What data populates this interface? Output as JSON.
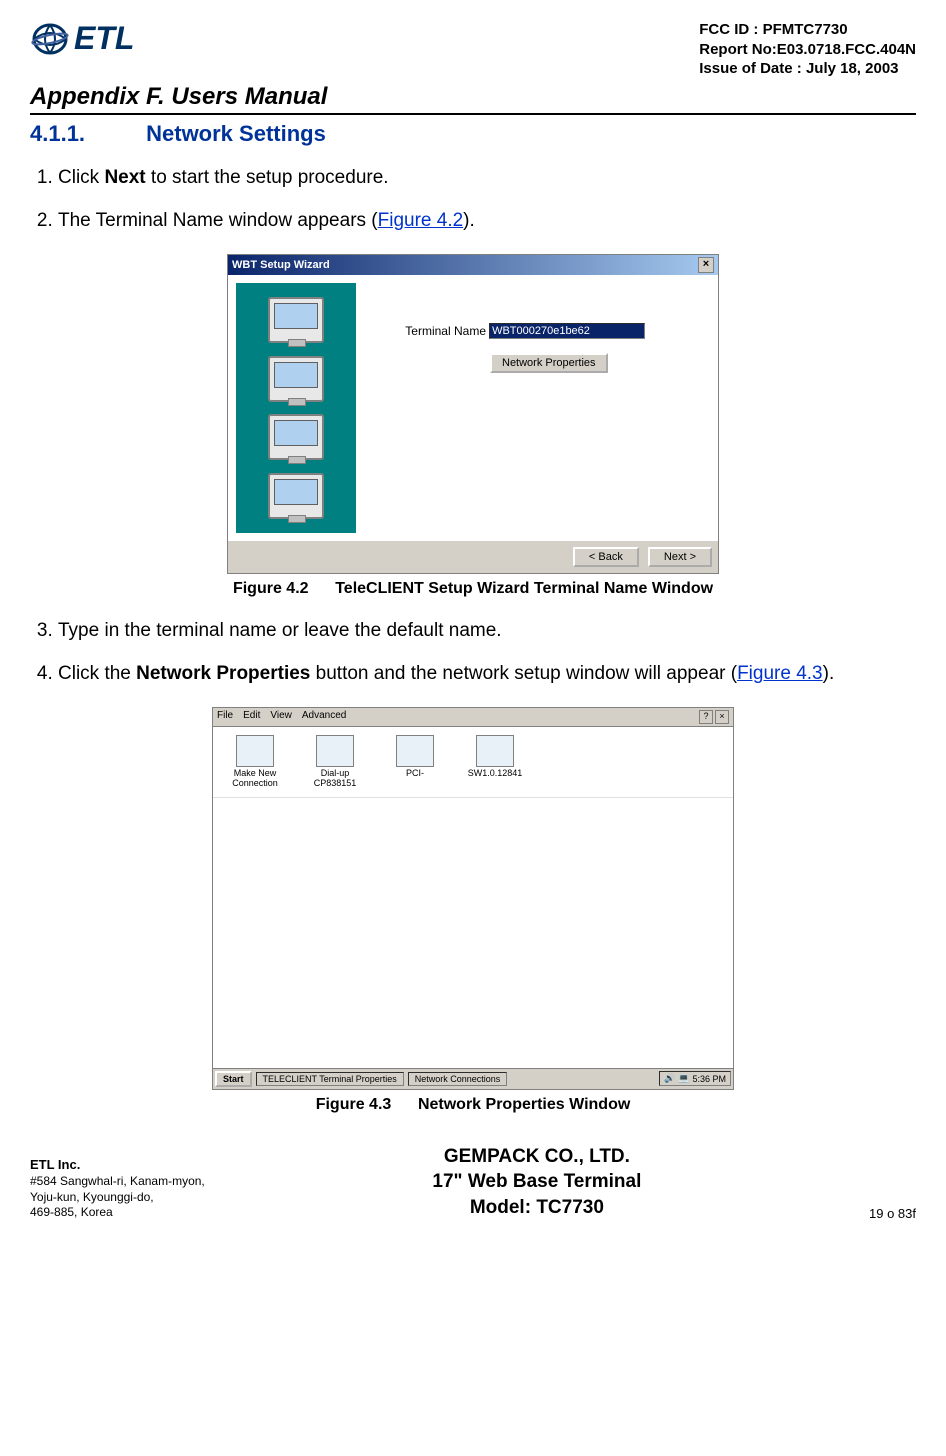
{
  "header": {
    "logo_text": "ETL",
    "fcc_id": "FCC ID : PFMTC7730",
    "report_no": "Report No:E03.0718.FCC.404N",
    "issue_date": "Issue of Date : July 18, 2003",
    "appendix": "Appendix F.  Users Manual"
  },
  "section": {
    "number": "4.1.1.",
    "title": "Network Settings"
  },
  "steps": {
    "s1_pre": "Click ",
    "s1_bold": "Next",
    "s1_post": " to start the setup procedure.",
    "s2_pre": "The Terminal Name window appears (",
    "s2_link": "Figure 4.2",
    "s2_post": ").",
    "s3": "Type in the terminal name or leave the default name.",
    "s4_pre": "Click the ",
    "s4_bold": "Network Properties",
    "s4_mid": " button and the network setup window will appear (",
    "s4_link": "Figure 4.3",
    "s4_post": ")."
  },
  "figure42": {
    "window_title": "WBT Setup Wizard",
    "terminal_label": "Terminal Name",
    "terminal_value": "WBT000270e1be62",
    "np_button": "Network Properties",
    "back": "<  Back",
    "next": "Next  >",
    "caption_num": "Figure 4.2",
    "caption_text": "TeleCLIENT Setup Wizard Terminal Name Window"
  },
  "figure43": {
    "menu": {
      "file": "File",
      "edit": "Edit",
      "view": "View",
      "advanced": "Advanced"
    },
    "icons": {
      "make_new": "Make New Connection",
      "dialup": "Dial-up CP838151",
      "pci": "PCI-",
      "sw": "SW1.0.12841"
    },
    "taskbar": {
      "start": "Start",
      "task1": "TELECLIENT Terminal Properties",
      "task2": "Network Connections",
      "clock": "5:36 PM"
    },
    "caption_num": "Figure 4.3",
    "caption_text": "Network Properties Window"
  },
  "footer": {
    "company": "ETL Inc.",
    "addr1": "#584 Sangwhal-ri, Kanam-myon,",
    "addr2": "Yoju-kun, Kyounggi-do,",
    "addr3": "469-885, Korea",
    "center1": "GEMPACK CO., LTD.",
    "center2": "17\" Web Base Terminal",
    "center3": "Model: TC7730",
    "page": "19 o 83f"
  }
}
